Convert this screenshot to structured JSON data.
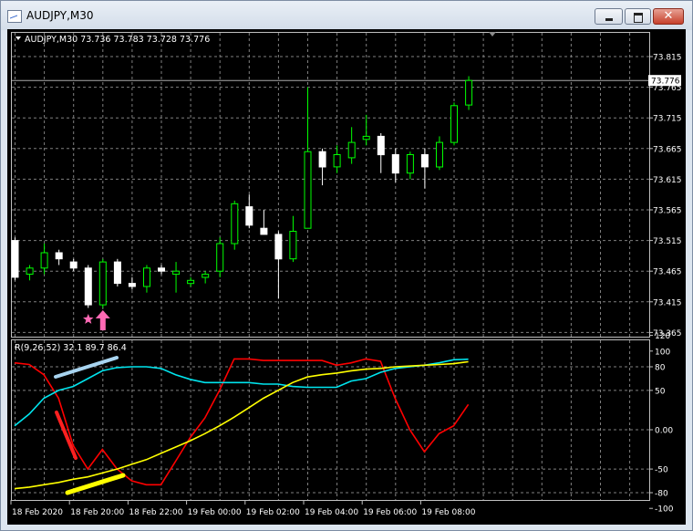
{
  "window": {
    "title": "AUDJPY,M30",
    "min_label": "▁",
    "max_label": "□",
    "close_label": "✕"
  },
  "main_panel": {
    "header": "AUDJPY,M30  73.736 73.783 73.728 73.776",
    "price_labels": [
      "73.815",
      "73.765",
      "73.715",
      "73.665",
      "73.615",
      "73.565",
      "73.515",
      "73.465",
      "73.415",
      "73.365"
    ],
    "current_price": "73.776"
  },
  "indicator_panel": {
    "header": "R(9,26,52) 32.1 89.7 86.4",
    "levels": [
      "120",
      "100",
      "80",
      "50",
      "0.00",
      "-50",
      "-80",
      "-100"
    ]
  },
  "time_axis": [
    "18 Feb 2020",
    "18 Feb 20:00",
    "18 Feb 22:00",
    "19 Feb 00:00",
    "19 Feb 02:00",
    "19 Feb 04:00",
    "19 Feb 06:00",
    "19 Feb 08:00"
  ],
  "colors": {
    "background": "#000000",
    "grid": "#7f7f7f",
    "bull": "#00ff00",
    "bear": "#ffffff",
    "fast": "#ff0000",
    "mid": "#00e5ee",
    "slow": "#ffff00",
    "marker": "#ff69b4"
  },
  "chart_data": [
    {
      "type": "candlestick",
      "symbol": "AUDJPY",
      "timeframe": "M30",
      "ylim": [
        73.365,
        73.83
      ],
      "candles": [
        {
          "t": 0,
          "o": 73.515,
          "h": 73.52,
          "l": 73.45,
          "c": 73.455
        },
        {
          "t": 1,
          "o": 73.46,
          "h": 73.475,
          "l": 73.45,
          "c": 73.47
        },
        {
          "t": 2,
          "o": 73.47,
          "h": 73.51,
          "l": 73.46,
          "c": 73.495
        },
        {
          "t": 3,
          "o": 73.495,
          "h": 73.5,
          "l": 73.475,
          "c": 73.485
        },
        {
          "t": 4,
          "o": 73.48,
          "h": 73.485,
          "l": 73.465,
          "c": 73.47
        },
        {
          "t": 5,
          "o": 73.47,
          "h": 73.475,
          "l": 73.405,
          "c": 73.41
        },
        {
          "t": 6,
          "o": 73.41,
          "h": 73.485,
          "l": 73.405,
          "c": 73.48
        },
        {
          "t": 7,
          "o": 73.48,
          "h": 73.485,
          "l": 73.44,
          "c": 73.445
        },
        {
          "t": 8,
          "o": 73.445,
          "h": 73.455,
          "l": 73.435,
          "c": 73.44
        },
        {
          "t": 9,
          "o": 73.44,
          "h": 73.475,
          "l": 73.43,
          "c": 73.47
        },
        {
          "t": 10,
          "o": 73.47,
          "h": 73.475,
          "l": 73.46,
          "c": 73.465
        },
        {
          "t": 11,
          "o": 73.46,
          "h": 73.48,
          "l": 73.43,
          "c": 73.465
        },
        {
          "t": 12,
          "o": 73.445,
          "h": 73.455,
          "l": 73.44,
          "c": 73.45
        },
        {
          "t": 13,
          "o": 73.455,
          "h": 73.465,
          "l": 73.445,
          "c": 73.46
        },
        {
          "t": 14,
          "o": 73.465,
          "h": 73.52,
          "l": 73.455,
          "c": 73.51
        },
        {
          "t": 15,
          "o": 73.51,
          "h": 73.58,
          "l": 73.5,
          "c": 73.575
        },
        {
          "t": 16,
          "o": 73.57,
          "h": 73.59,
          "l": 73.535,
          "c": 73.54
        },
        {
          "t": 17,
          "o": 73.535,
          "h": 73.565,
          "l": 73.53,
          "c": 73.525
        },
        {
          "t": 18,
          "o": 73.525,
          "h": 73.53,
          "l": 73.42,
          "c": 73.485
        },
        {
          "t": 19,
          "o": 73.485,
          "h": 73.555,
          "l": 73.48,
          "c": 73.53
        },
        {
          "t": 20,
          "o": 73.535,
          "h": 73.765,
          "l": 73.535,
          "c": 73.66
        },
        {
          "t": 21,
          "o": 73.66,
          "h": 73.665,
          "l": 73.605,
          "c": 73.635
        },
        {
          "t": 22,
          "o": 73.635,
          "h": 73.67,
          "l": 73.625,
          "c": 73.655
        },
        {
          "t": 23,
          "o": 73.65,
          "h": 73.7,
          "l": 73.64,
          "c": 73.675
        },
        {
          "t": 24,
          "o": 73.68,
          "h": 73.72,
          "l": 73.67,
          "c": 73.685
        },
        {
          "t": 25,
          "o": 73.685,
          "h": 73.69,
          "l": 73.625,
          "c": 73.655
        },
        {
          "t": 26,
          "o": 73.655,
          "h": 73.665,
          "l": 73.61,
          "c": 73.625
        },
        {
          "t": 27,
          "o": 73.625,
          "h": 73.66,
          "l": 73.615,
          "c": 73.655
        },
        {
          "t": 28,
          "o": 73.655,
          "h": 73.665,
          "l": 73.6,
          "c": 73.635
        },
        {
          "t": 29,
          "o": 73.635,
          "h": 73.685,
          "l": 73.63,
          "c": 73.675
        },
        {
          "t": 30,
          "o": 73.675,
          "h": 73.74,
          "l": 73.67,
          "c": 73.735
        },
        {
          "t": 31,
          "o": 73.736,
          "h": 73.783,
          "l": 73.728,
          "c": 73.776
        }
      ],
      "markers": [
        {
          "t": 5,
          "shape": "star"
        },
        {
          "t": 6,
          "shape": "up-arrow"
        }
      ]
    },
    {
      "type": "line",
      "name_label": "R(9,26,52)",
      "ylim": [
        -110,
        130
      ],
      "series": [
        {
          "name": "fast",
          "color": "#ff0000",
          "values": [
            85,
            83,
            70,
            40,
            -20,
            -50,
            -25,
            -50,
            -65,
            -70,
            -70,
            -40,
            -10,
            15,
            50,
            90,
            90,
            88,
            88,
            88,
            88,
            88,
            82,
            85,
            90,
            87,
            40,
            0,
            -28,
            -5,
            5,
            32.1
          ]
        },
        {
          "name": "mid",
          "color": "#00e5ee",
          "values": [
            5,
            20,
            40,
            50,
            55,
            65,
            75,
            79,
            80,
            80,
            78,
            70,
            64,
            60,
            60,
            60,
            60,
            58,
            58,
            55,
            54,
            54,
            54,
            62,
            65,
            73,
            78,
            80,
            82,
            85,
            89,
            89.7
          ]
        },
        {
          "name": "slow",
          "color": "#ffff00",
          "values": [
            -75,
            -73,
            -70,
            -67,
            -63,
            -60,
            -55,
            -50,
            -44,
            -38,
            -30,
            -22,
            -14,
            -5,
            5,
            16,
            28,
            40,
            50,
            60,
            67,
            70,
            72,
            75,
            77,
            78,
            80,
            81,
            82,
            83,
            84,
            86.4
          ]
        }
      ]
    }
  ]
}
